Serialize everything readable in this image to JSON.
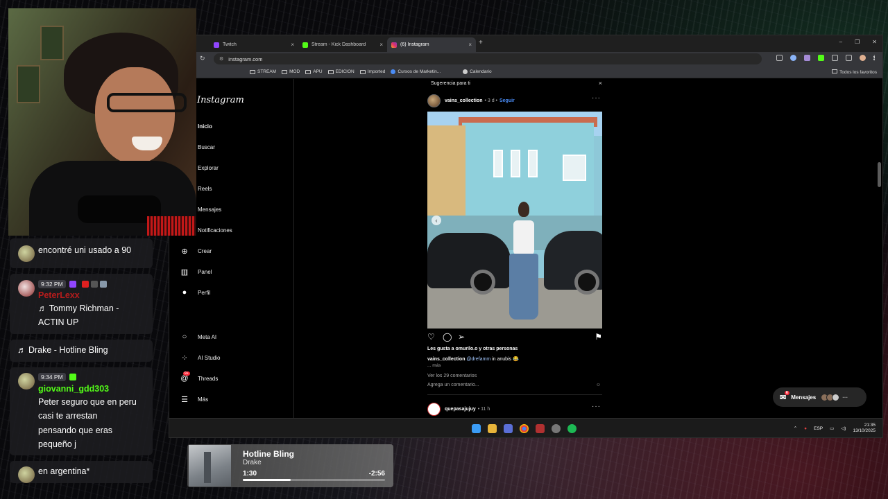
{
  "colors": {
    "twitch": "#9146ff",
    "kick": "#53fc18",
    "instagram": "#e1306c",
    "ig_link": "#4a8cf5",
    "notification_badge": "#ff3040"
  },
  "browser": {
    "tabs": [
      {
        "label": "Twitch",
        "icon": "twitch-icon",
        "close": "×"
      },
      {
        "label": "Stream - Kick Dashboard",
        "icon": "kick-icon",
        "close": "×"
      },
      {
        "label": "(6) Instagram",
        "icon": "instagram-icon",
        "close": "×"
      }
    ],
    "new_tab": "+",
    "window_controls": {
      "minimize": "–",
      "restore": "❐",
      "close": "✕"
    },
    "reload": "↻",
    "url": "instagram.com",
    "bookmarks": [
      {
        "label": "STREAM",
        "type": "folder"
      },
      {
        "label": "MOD",
        "type": "folder"
      },
      {
        "label": "APU",
        "type": "folder"
      },
      {
        "label": "EDICION",
        "type": "folder"
      },
      {
        "label": "Imported",
        "type": "folder"
      },
      {
        "label": "Cursos de Marketin...",
        "type": "site"
      },
      {
        "label": "Calendario",
        "type": "site"
      }
    ],
    "bookmarks_right": "Todos los favoritos"
  },
  "instagram": {
    "logo": "Instagram",
    "nav": [
      {
        "label": "Inicio",
        "icon": "home-icon",
        "glyph": "⌂",
        "bold": true
      },
      {
        "label": "Buscar",
        "icon": "search-icon",
        "glyph": "⌕"
      },
      {
        "label": "Explorar",
        "icon": "compass-icon",
        "glyph": "◎"
      },
      {
        "label": "Reels",
        "icon": "reels-icon",
        "glyph": "▣"
      },
      {
        "label": "Mensajes",
        "icon": "messages-icon",
        "glyph": "✉"
      },
      {
        "label": "Notificaciones",
        "icon": "heart-icon",
        "glyph": "♡"
      },
      {
        "label": "Crear",
        "icon": "plus-icon",
        "glyph": "⊕"
      },
      {
        "label": "Panel",
        "icon": "chart-icon",
        "glyph": "▥"
      },
      {
        "label": "Perfil",
        "icon": "profile-avatar-icon",
        "glyph": "●"
      },
      {
        "label": "Meta AI",
        "icon": "meta-ai-icon",
        "glyph": "○"
      },
      {
        "label": "AI Studio",
        "icon": "ai-studio-icon",
        "glyph": "⁘"
      },
      {
        "label": "Threads",
        "icon": "threads-icon",
        "glyph": "@",
        "badge": "9+"
      },
      {
        "label": "Más",
        "icon": "menu-icon",
        "glyph": "☰"
      }
    ],
    "post": {
      "suggestion_header": "Sugerencia para ti",
      "close": "×",
      "username": "vains_collection",
      "meta": "• 3 d •",
      "follow": "Seguir",
      "more_options": "···",
      "likes": "Les gusta a omurilo.o y otras personas",
      "caption_user": "vains_collection",
      "caption_mention": "@drefamm",
      "caption_text": "in anubis 😂",
      "caption_more": "... más",
      "view_comments": "Ver los 29 comentarios",
      "add_comment": "Agrega un comentario...",
      "emoji": "☺"
    },
    "next_post": {
      "username": "quepasajujuy",
      "meta": "• 11 h",
      "more_options": "···"
    },
    "messages_pill": {
      "label": "Mensajes",
      "badge": "6",
      "more": "···"
    }
  },
  "taskbar": {
    "lang": "ESP",
    "time": "21:35",
    "date": "13/10/2025"
  },
  "chat": [
    {
      "text": "encontré uni usado a 90"
    },
    {
      "time": "9:32 PM",
      "username": "PeterLexx",
      "line1": "♬ Tommy Richman -",
      "line2": "ACTIN UP"
    },
    {
      "text": "♬ Drake - Hotline Bling"
    },
    {
      "time": "9:34 PM",
      "username": "giovanni_gdd303",
      "lines": [
        "Peter seguro que en peru",
        "casi te arrestan",
        "pensando que eras",
        "pequeño j"
      ]
    },
    {
      "text": "en argentina*"
    }
  ],
  "now_playing": {
    "title": "Hotline Bling",
    "artist": "Drake",
    "elapsed": "1:30",
    "remaining": "-2:56",
    "progress": 0.338
  }
}
